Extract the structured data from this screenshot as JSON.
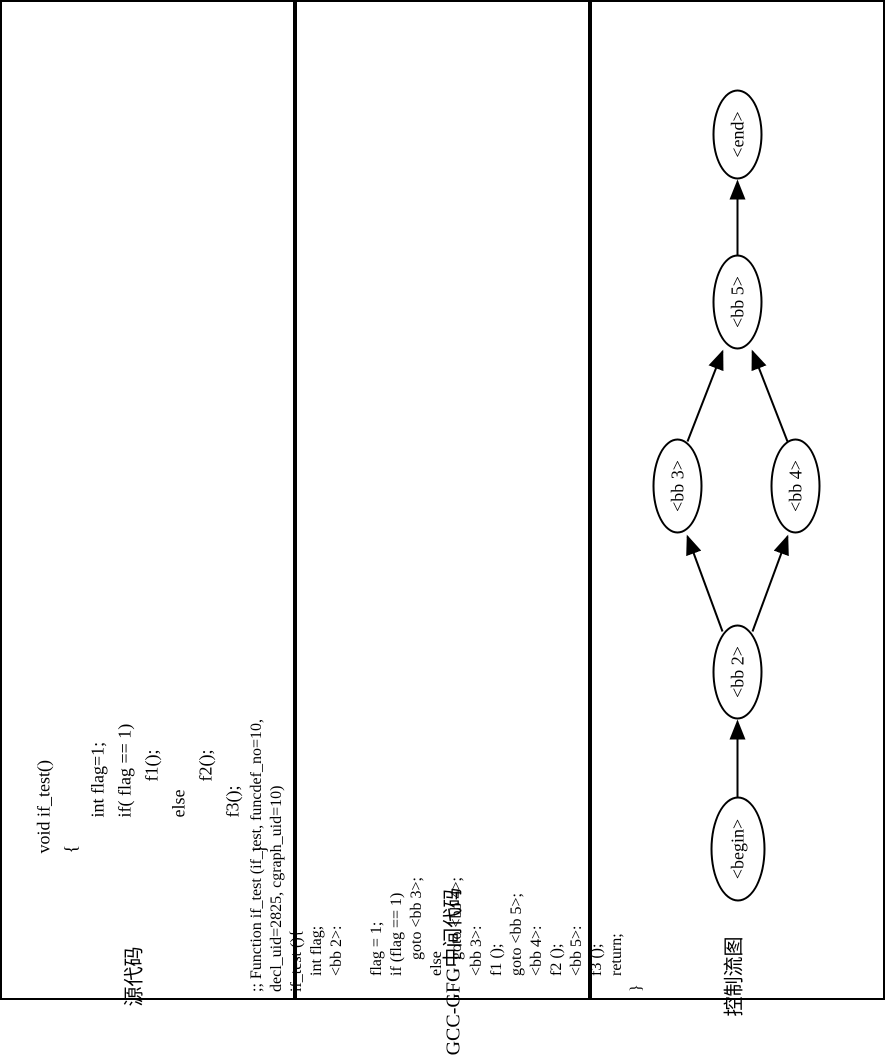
{
  "panels": {
    "source": {
      "label": "源代码",
      "code": "void if_test()\n{\n        int flag=1;\n        if( flag == 1)\n                f1();\n        else\n                f2();\n        f3();\n}"
    },
    "intermediate": {
      "label": "GCC-GFG中间代码",
      "code": ";; Function if_test (if_test, funcdef_no=10,\ndecl_uid=2825, cgraph_uid=10)\nif_test (){\n    int flag;\n    <bb 2>:\n\n    flag = 1;\n    if (flag == 1)\n        goto <bb 3>;\n    else\n        goto <bb 4>;\n    <bb 3>:\n    f1 ();\n    goto <bb 5>;\n    <bb 4>:\n    f2 ();\n    <bb 5>:\n    f3 ();\n    return;\n}"
    },
    "cfg": {
      "label": "控制流图",
      "nodes": {
        "begin": "<begin>",
        "bb2": "<bb 2>",
        "bb3": "<bb 3>",
        "bb4": "<bb 4>",
        "bb5": "<bb 5>",
        "end": "<end>"
      },
      "edges": [
        {
          "from": "begin",
          "to": "bb2"
        },
        {
          "from": "bb2",
          "to": "bb3"
        },
        {
          "from": "bb2",
          "to": "bb4"
        },
        {
          "from": "bb3",
          "to": "bb5"
        },
        {
          "from": "bb4",
          "to": "bb5"
        },
        {
          "from": "bb5",
          "to": "end"
        }
      ]
    }
  }
}
